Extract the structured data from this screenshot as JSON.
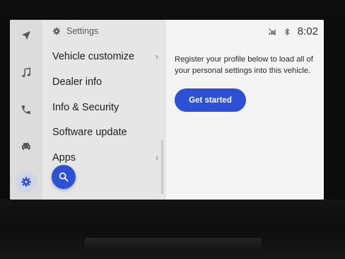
{
  "status_bar": {
    "clock": "8:02",
    "icons": [
      "no-signal-icon",
      "bluetooth-icon"
    ]
  },
  "rail": {
    "items": [
      {
        "icon": "navigation-icon",
        "active": false
      },
      {
        "icon": "music-note-icon",
        "active": false
      },
      {
        "icon": "phone-icon",
        "active": false
      },
      {
        "icon": "car-icon",
        "active": false
      },
      {
        "icon": "settings-gear-icon",
        "active": true
      }
    ],
    "accent_color": "#2c51d6"
  },
  "settings": {
    "title": "Settings",
    "items": [
      {
        "label": "Vehicle customize",
        "has_chevron": true
      },
      {
        "label": "Dealer info",
        "has_chevron": false
      },
      {
        "label": "Info & Security",
        "has_chevron": false
      },
      {
        "label": "Software update",
        "has_chevron": false
      },
      {
        "label": "Apps",
        "has_chevron": true
      }
    ],
    "search_button_icon": "search-icon"
  },
  "profile": {
    "message": "Register your profile below to load all of your personal settings into this vehicle.",
    "button_label": "Get started",
    "button_color": "#2c51d6"
  }
}
